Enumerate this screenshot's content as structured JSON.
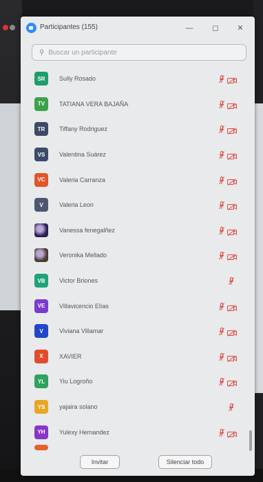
{
  "window": {
    "title": "Participantes (155)",
    "minimize_glyph": "—",
    "maximize_glyph": "◻",
    "close_glyph": "✕"
  },
  "search": {
    "placeholder": "Buscar un participante",
    "value": ""
  },
  "participants": [
    {
      "initials": "SR",
      "name": "Sully Rosado",
      "color": "#1e9e6b",
      "mic_muted": true,
      "cam_off": true
    },
    {
      "initials": "TV",
      "name": "TATIANA VERA BAJAÑA",
      "color": "#3aa34a",
      "mic_muted": true,
      "cam_off": true
    },
    {
      "initials": "TR",
      "name": "Tiffany Rodriguez",
      "color": "#3b4a66",
      "mic_muted": true,
      "cam_off": true
    },
    {
      "initials": "VS",
      "name": "Valentina Suárez",
      "color": "#3c4b6a",
      "mic_muted": true,
      "cam_off": true
    },
    {
      "initials": "VC",
      "name": "Valeria Carranza",
      "color": "#e0572a",
      "mic_muted": true,
      "cam_off": true
    },
    {
      "initials": "V",
      "name": "Valeria Leon",
      "color": "#4d5870",
      "mic_muted": true,
      "cam_off": true
    },
    {
      "initials": "",
      "name": "Vanessa fenegalñez",
      "color": "#2b1e55",
      "mic_muted": true,
      "cam_off": true,
      "photo": true
    },
    {
      "initials": "",
      "name": "Veronika Mellado",
      "color": "#4a3b30",
      "mic_muted": true,
      "cam_off": true,
      "photo": true
    },
    {
      "initials": "VB",
      "name": "Victor Briones",
      "color": "#1ea37a",
      "mic_muted": true,
      "cam_off": false
    },
    {
      "initials": "VE",
      "name": "Villavicencio Elías",
      "color": "#7a3bcf",
      "mic_muted": true,
      "cam_off": true
    },
    {
      "initials": "V",
      "name": "Viviana Villamar",
      "color": "#2046c9",
      "mic_muted": true,
      "cam_off": true
    },
    {
      "initials": "X",
      "name": "XAVIER",
      "color": "#e24c2c",
      "mic_muted": true,
      "cam_off": true
    },
    {
      "initials": "YL",
      "name": "Yiu Logroño",
      "color": "#2ea35c",
      "mic_muted": true,
      "cam_off": true
    },
    {
      "initials": "YS",
      "name": "yajaira solano",
      "color": "#e8a623",
      "mic_muted": true,
      "cam_off": false
    },
    {
      "initials": "YH",
      "name": "Yulexy Hernandez",
      "color": "#8a35c9",
      "mic_muted": true,
      "cam_off": true
    },
    {
      "initials": "",
      "name": "",
      "color": "#e5622c",
      "mic_muted": false,
      "cam_off": false,
      "partial": true
    }
  ],
  "footer": {
    "invite_label": "Invitar",
    "mute_all_label": "Silenciar todo"
  },
  "colors": {
    "muted_red": "#e0473f",
    "window_bg": "#e9eaec"
  }
}
